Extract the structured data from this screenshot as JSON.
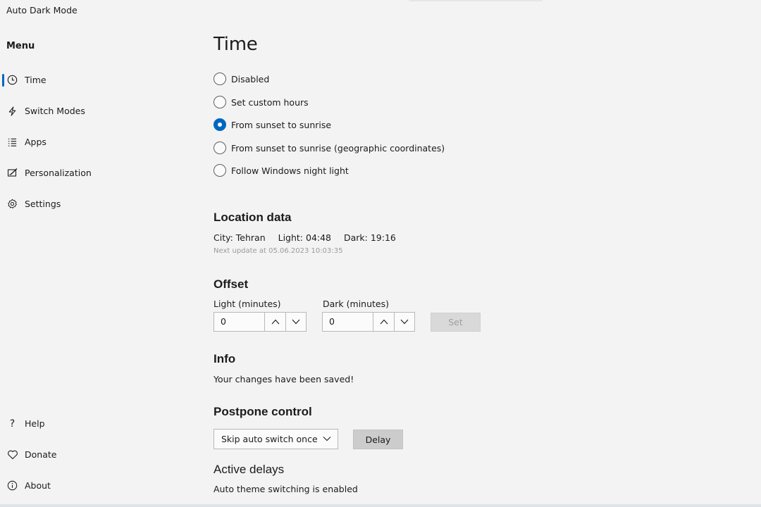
{
  "app": {
    "title": "Auto Dark Mode"
  },
  "sidebar": {
    "heading": "Menu",
    "items": [
      {
        "label": "Time",
        "icon": "clock-icon",
        "selected": true
      },
      {
        "label": "Switch Modes",
        "icon": "lightning-icon"
      },
      {
        "label": "Apps",
        "icon": "list-icon"
      },
      {
        "label": "Personalization",
        "icon": "personalize-icon"
      },
      {
        "label": "Settings",
        "icon": "gear-icon"
      }
    ],
    "bottom_items": [
      {
        "label": "Help",
        "icon": "question-icon"
      },
      {
        "label": "Donate",
        "icon": "heart-icon"
      },
      {
        "label": "About",
        "icon": "info-icon"
      }
    ]
  },
  "main": {
    "title": "Time",
    "radio_options": [
      {
        "label": "Disabled",
        "checked": false
      },
      {
        "label": "Set custom hours",
        "checked": false
      },
      {
        "label": "From sunset to sunrise",
        "checked": true
      },
      {
        "label": "From sunset to sunrise (geographic coordinates)",
        "checked": false
      },
      {
        "label": "Follow Windows night light",
        "checked": false
      }
    ],
    "location": {
      "title": "Location data",
      "city": "City: Tehran",
      "light": "Light: 04:48",
      "dark": "Dark: 19:16",
      "next_update": "Next update at 05.06.2023 10:03:35"
    },
    "offset": {
      "title": "Offset",
      "light_label": "Light (minutes)",
      "light_value": "0",
      "dark_label": "Dark (minutes)",
      "dark_value": "0",
      "set_label": "Set"
    },
    "info": {
      "title": "Info",
      "message": "Your changes have been saved!"
    },
    "postpone": {
      "title": "Postpone control",
      "selected_option": "Skip auto switch once",
      "delay_label": "Delay"
    },
    "active_delays": {
      "title": "Active delays",
      "status": "Auto theme switching is enabled"
    }
  },
  "colors": {
    "accent": "#0067c0",
    "background": "#f3f3f3",
    "disabled_button": "#d9d9d9"
  }
}
